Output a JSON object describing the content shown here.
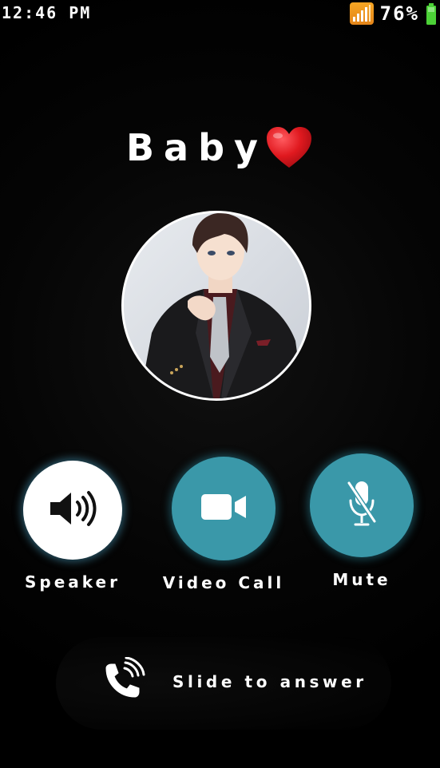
{
  "status_bar": {
    "time": "12:46 PM",
    "battery_percent": "76%",
    "signal_icon": "signal-bars-icon",
    "battery_icon": "battery-charging-icon"
  },
  "caller": {
    "name": "Baby",
    "emoji_icon": "red-heart-icon"
  },
  "avatar": {
    "description_icon": "caller-avatar"
  },
  "actions": {
    "speaker": {
      "label": "Speaker",
      "icon": "speaker-icon"
    },
    "video_call": {
      "label": "Video Call",
      "icon": "video-camera-icon"
    },
    "mute": {
      "label": "Mute",
      "icon": "microphone-off-icon"
    }
  },
  "answer": {
    "label": "Slide to answer",
    "icon": "phone-ringing-icon"
  },
  "colors": {
    "background": "#000000",
    "action_teal": "#3a98a9",
    "heart_red": "#e0191f",
    "signal_orange": "#f6a623",
    "battery_green": "#4cd137"
  }
}
